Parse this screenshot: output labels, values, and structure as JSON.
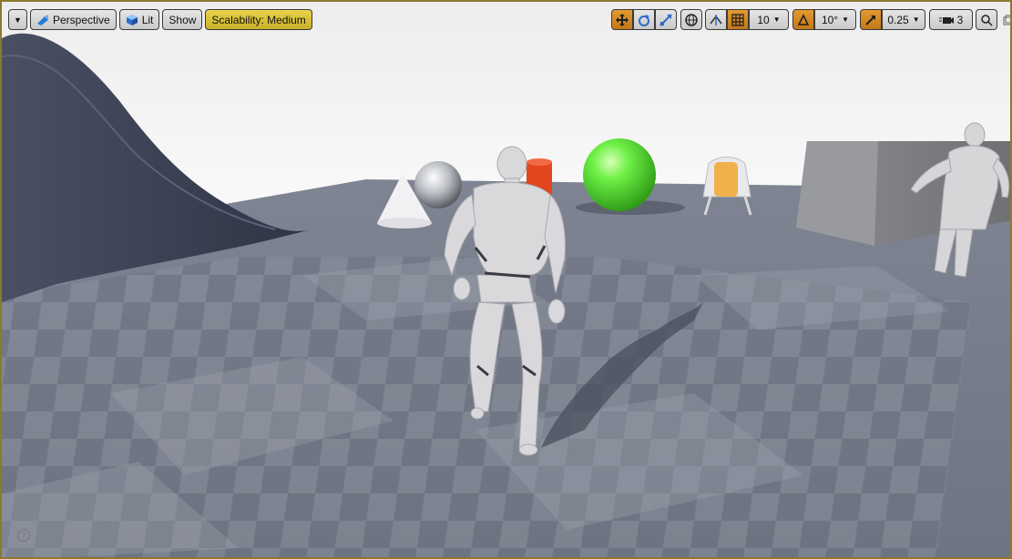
{
  "toolbar": {
    "view_mode": "Perspective",
    "lighting": "Lit",
    "show": "Show",
    "scalability": "Scalability: Medium",
    "grid_snap": "10",
    "rotation_snap": "10°",
    "scale_snap": "0.25",
    "camera_speed": "3"
  },
  "help_icon": "?",
  "colors": {
    "accent_orange": "#d4892a",
    "accent_yellow": "#d8c23a",
    "sky_top": "#f3f3f3",
    "floor_dark": "#5c6170",
    "floor_light": "#8a8f9b",
    "sphere_green": "#5ee83a",
    "cylinder_red": "#e44a22",
    "chair_orange": "#f0b04a"
  }
}
